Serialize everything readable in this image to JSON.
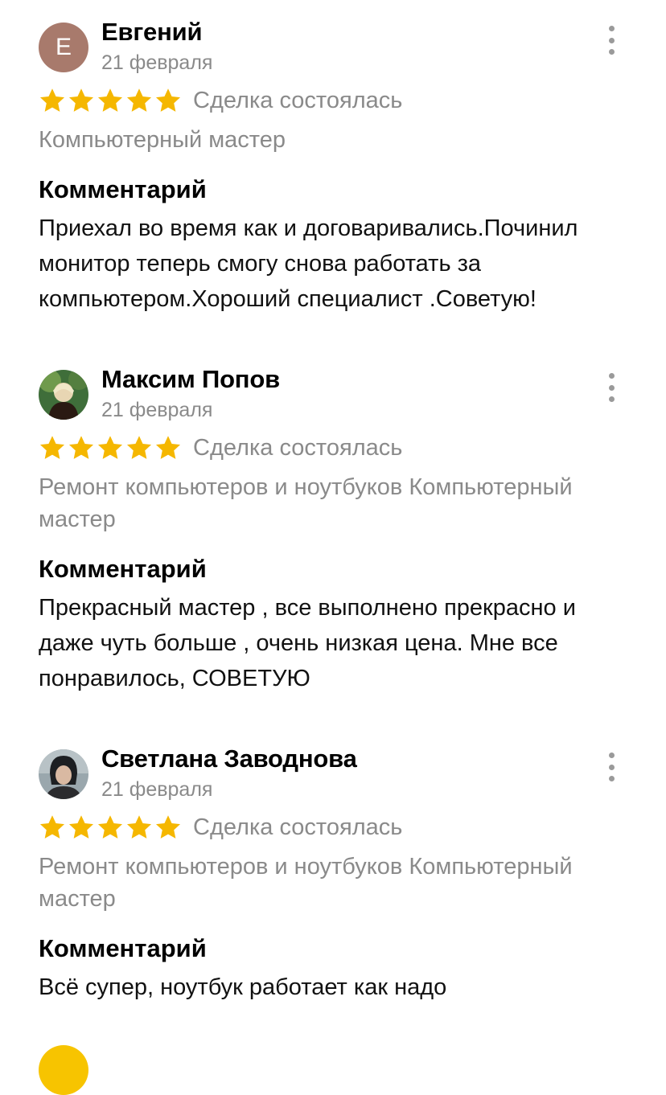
{
  "reviews": [
    {
      "avatar_letter": "Е",
      "name": "Евгений",
      "date": "21 февраля",
      "rating": 5,
      "deal_status": "Сделка состоялась",
      "category": "Компьютерный мастер",
      "comment_title": "Комментарий",
      "comment_text": "Приехал во время как и договаривались.Починил монитор теперь смогу снова работать за компьютером.Хороший специалист .Советую!"
    },
    {
      "name": "Максим Попов",
      "date": "21 февраля",
      "rating": 5,
      "deal_status": "Сделка состоялась",
      "category": "Ремонт компьютеров и ноутбуков Компьютерный мастер",
      "comment_title": "Комментарий",
      "comment_text": "Прекрасный мастер , все выполнено прекрасно и даже чуть больше , очень низкая цена. Мне все понравилось, СОВЕТУЮ"
    },
    {
      "name": "Светлана Заводнова",
      "date": "21 февраля",
      "rating": 5,
      "deal_status": "Сделка состоялась",
      "category": "Ремонт компьютеров и ноутбуков Компьютерный мастер",
      "comment_title": "Комментарий",
      "comment_text": "Всё супер, ноутбук работает как надо"
    }
  ],
  "colors": {
    "star": "#f5b700",
    "muted_text": "#8a8a8a",
    "avatar_letter_bg": "#a87a6c"
  }
}
